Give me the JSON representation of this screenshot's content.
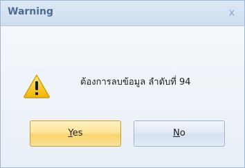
{
  "dialog": {
    "title": "Warning",
    "close_glyph": "x",
    "icon": "warning-triangle-icon",
    "message": "ต้องการลบข้อมูล ลำดับที่ 94"
  },
  "buttons": {
    "yes": {
      "mnemonic": "Y",
      "rest": "es"
    },
    "no": {
      "mnemonic": "N",
      "rest": "o"
    }
  },
  "colors": {
    "title_text": "#4a6b92",
    "yes_button": "#f9d46d",
    "no_button": "#d5e0f0",
    "warning_icon": "#f5c400"
  }
}
